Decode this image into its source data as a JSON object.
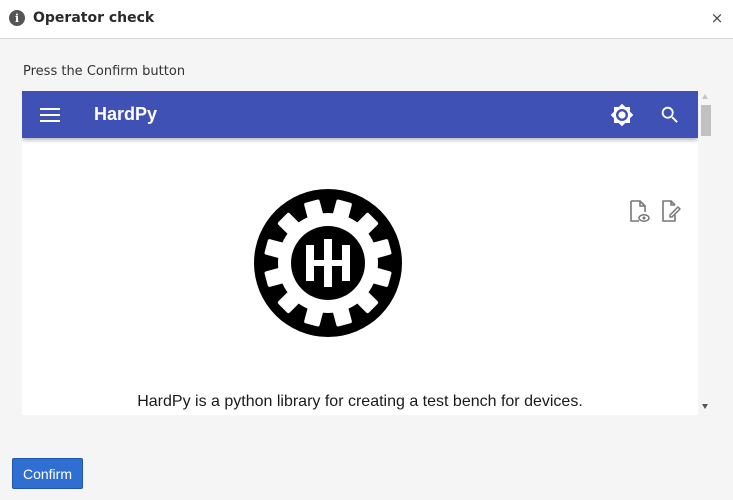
{
  "dialog": {
    "title": "Operator check",
    "info_icon": "info-icon",
    "info_glyph": "i",
    "close_icon": "close-icon",
    "close_glyph": "×"
  },
  "prompt": "Press the Confirm button",
  "embedded_page": {
    "app_title": "HardPy",
    "appbar_color": "#3f51b5",
    "icons": [
      "menu-icon",
      "theme-toggle-icon",
      "search-icon",
      "view-source-icon",
      "edit-page-icon",
      "hardpy-logo-icon"
    ],
    "description": "HardPy is a python library for creating a test bench for devices."
  },
  "buttons": {
    "confirm_label": "Confirm",
    "confirm_color": "#2f6fd2"
  }
}
